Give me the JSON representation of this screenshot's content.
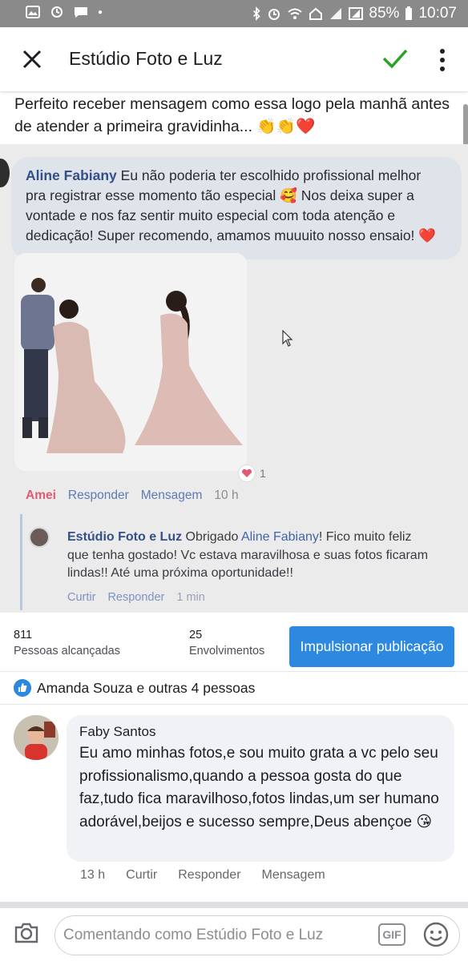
{
  "status_bar": {
    "battery": "85%",
    "time": "10:07"
  },
  "header": {
    "title": "Estúdio Foto e Luz"
  },
  "post": {
    "caption_line1": "Perfeito receber mensagem como essa logo pela manhã antes",
    "caption_line2": "de atender a primeira gravidinha... 👏👏❤️"
  },
  "embedded_comment": {
    "author": "Aline Fabiany",
    "text": "Eu não poderia ter escolhido profissional melhor pra registrar esse momento tão especial 🥰 Nos deixa super a vontade e nos faz sentir muito especial com toda atenção e dedicação! Super recomendo, amamos muuuito nosso ensaio! ❤️",
    "reaction_count": "1",
    "actions": {
      "reacted": "Amei",
      "reply": "Responder",
      "message": "Mensagem",
      "time": "10 h"
    },
    "reply": {
      "author": "Estúdio Foto e Luz",
      "text_before_tag": "Obrigado",
      "tag": "Aline Fabiany",
      "text_after_tag": "! Fico muito feliz que tenha gostado! Vc estava maravilhosa e suas fotos ficaram lindas!! Até uma próxima oportunidade!!",
      "like": "Curtir",
      "reply_label": "Responder",
      "time": "1 min"
    }
  },
  "stats": {
    "reached_count": "811",
    "reached_label": "Pessoas alcançadas",
    "engagement_count": "25",
    "engagement_label": "Envolvimentos",
    "boost_label": "Impulsionar publicação"
  },
  "likes": {
    "summary": "Amanda Souza e outras 4 pessoas"
  },
  "comment": {
    "author": "Faby Santos",
    "text": "Eu amo minhas fotos,e sou muito grata a vc pelo seu profissionalismo,quando a pessoa gosta do que faz,tudo fica maravilhoso,fotos lindas,um ser humano adorável,beijos e sucesso sempre,Deus abençoe 😘",
    "time": "13 h",
    "like": "Curtir",
    "reply": "Responder",
    "message": "Mensagem"
  },
  "composer": {
    "placeholder": "Comentando como Estúdio Foto e Luz",
    "gif_label": "GIF"
  },
  "colors": {
    "accent": "#2d88e0",
    "check_green": "#27a327",
    "status_bar": "#8a8a8a"
  },
  "icons": [
    "close-icon",
    "check-icon",
    "more-icon",
    "like-icon",
    "camera-icon",
    "gif-icon",
    "emoji-icon"
  ]
}
